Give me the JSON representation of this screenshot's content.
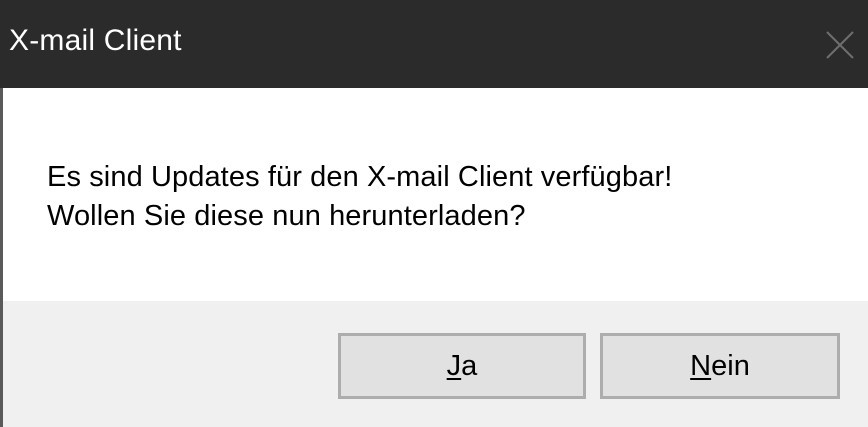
{
  "window": {
    "title": "X-mail Client",
    "close_icon": "close-icon"
  },
  "message": {
    "line1": "Es sind Updates für den X-mail Client verfügbar!",
    "line2": "Wollen Sie diese nun herunterladen?"
  },
  "buttons": {
    "yes": {
      "mnemonic": "J",
      "rest": "a"
    },
    "no": {
      "mnemonic": "N",
      "rest": "ein"
    }
  },
  "colors": {
    "titlebar": "#2b2b2b",
    "button_area": "#f0f0f0",
    "button_face": "#e1e1e1",
    "button_border": "#adadad"
  }
}
